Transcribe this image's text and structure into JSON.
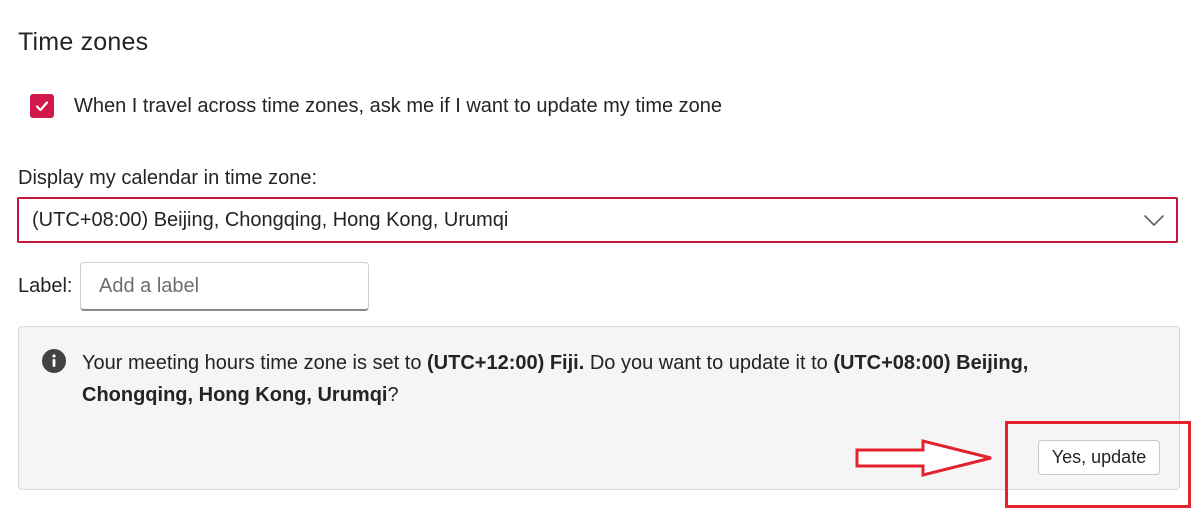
{
  "section": {
    "title": "Time zones"
  },
  "travel_prompt": {
    "checked": true,
    "label": "When I travel across time zones, ask me if I want to update my time zone"
  },
  "calendar_timezone": {
    "label": "Display my calendar in time zone:",
    "selected": "(UTC+08:00) Beijing, Chongqing, Hong Kong, Urumqi"
  },
  "label_field": {
    "label": "Label:",
    "value": "",
    "placeholder": "Add a label"
  },
  "info_banner": {
    "text_before": "Your meeting hours time zone is set to ",
    "current_zone": "(UTC+12:00) Fiji.",
    "text_middle": " Do you want to update it to ",
    "new_zone": "(UTC+08:00) Beijing, Chongqing, Hong Kong, Urumqi",
    "text_after": "?",
    "button_label": "Yes, update"
  },
  "colors": {
    "accent": "#d2194b",
    "annotation_red": "#e2222d",
    "banner_background": "#f5f5f5"
  },
  "icons": {
    "checkbox": "checkmark-icon",
    "dropdown": "chevron-down-icon",
    "info": "info-icon",
    "annotation": "arrow-right-icon"
  }
}
